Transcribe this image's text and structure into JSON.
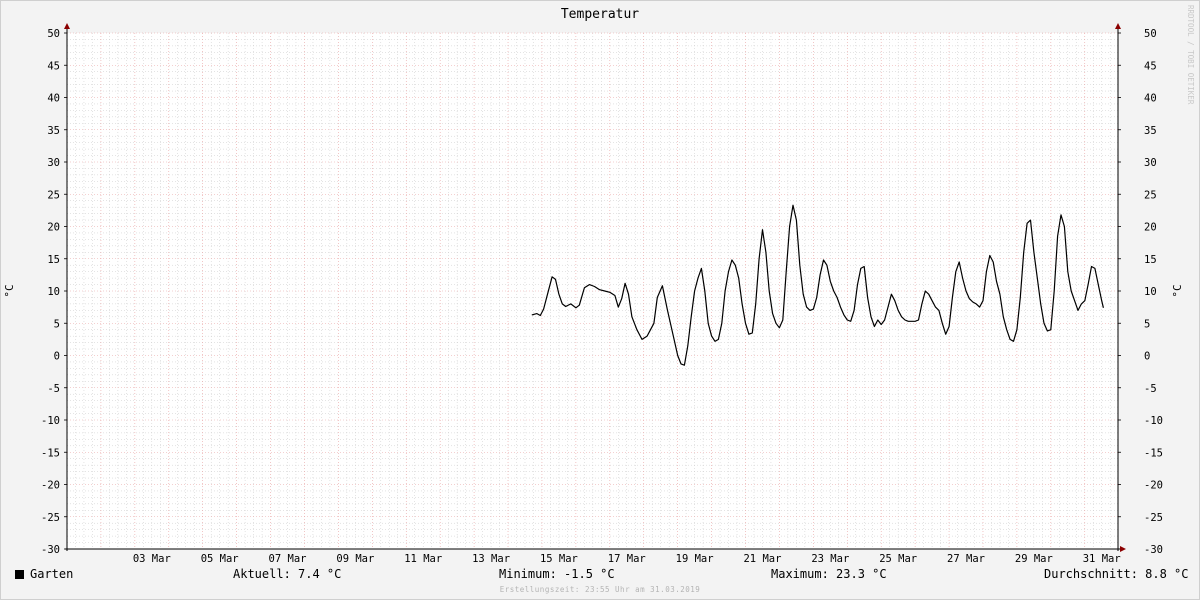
{
  "chart_data": {
    "type": "line",
    "title": "Temperatur",
    "ylabel": "°C",
    "ylim": [
      -30,
      50
    ],
    "yticks": [
      -30,
      -25,
      -20,
      -15,
      -10,
      -5,
      0,
      5,
      10,
      15,
      20,
      25,
      30,
      35,
      40,
      45,
      50
    ],
    "xlim_days": [
      1,
      31
    ],
    "xtick_labels": [
      {
        "day": 3,
        "label": "03 Mar"
      },
      {
        "day": 5,
        "label": "05 Mar"
      },
      {
        "day": 7,
        "label": "07 Mar"
      },
      {
        "day": 9,
        "label": "09 Mar"
      },
      {
        "day": 11,
        "label": "11 Mar"
      },
      {
        "day": 13,
        "label": "13 Mar"
      },
      {
        "day": 15,
        "label": "15 Mar"
      },
      {
        "day": 17,
        "label": "17 Mar"
      },
      {
        "day": 19,
        "label": "19 Mar"
      },
      {
        "day": 21,
        "label": "21 Mar"
      },
      {
        "day": 23,
        "label": "23 Mar"
      },
      {
        "day": 25,
        "label": "25 Mar"
      },
      {
        "day": 27,
        "label": "27 Mar"
      },
      {
        "day": 29,
        "label": "29 Mar"
      },
      {
        "day": 31,
        "label": "31 Mar"
      }
    ],
    "grid": true,
    "series": [
      {
        "name": "Garten",
        "color": "#000000",
        "points": [
          [
            14.7,
            6.3
          ],
          [
            14.85,
            6.5
          ],
          [
            14.95,
            6.2
          ],
          [
            15.05,
            7.2
          ],
          [
            15.2,
            10.2
          ],
          [
            15.3,
            12.2
          ],
          [
            15.4,
            11.8
          ],
          [
            15.5,
            9.5
          ],
          [
            15.6,
            8.0
          ],
          [
            15.7,
            7.6
          ],
          [
            15.85,
            8.0
          ],
          [
            16.0,
            7.4
          ],
          [
            16.1,
            7.8
          ],
          [
            16.25,
            10.5
          ],
          [
            16.4,
            11.0
          ],
          [
            16.55,
            10.7
          ],
          [
            16.7,
            10.2
          ],
          [
            16.85,
            10.0
          ],
          [
            17.0,
            9.8
          ],
          [
            17.15,
            9.3
          ],
          [
            17.25,
            7.5
          ],
          [
            17.35,
            8.8
          ],
          [
            17.45,
            11.2
          ],
          [
            17.55,
            9.5
          ],
          [
            17.65,
            6.0
          ],
          [
            17.8,
            4.0
          ],
          [
            17.95,
            2.5
          ],
          [
            18.1,
            3.0
          ],
          [
            18.2,
            4.0
          ],
          [
            18.3,
            5.0
          ],
          [
            18.4,
            9.0
          ],
          [
            18.55,
            10.8
          ],
          [
            18.7,
            7.0
          ],
          [
            18.85,
            3.5
          ],
          [
            19.0,
            0.0
          ],
          [
            19.1,
            -1.3
          ],
          [
            19.2,
            -1.5
          ],
          [
            19.3,
            1.5
          ],
          [
            19.4,
            6.0
          ],
          [
            19.5,
            10.0
          ],
          [
            19.6,
            12.0
          ],
          [
            19.7,
            13.5
          ],
          [
            19.8,
            10.0
          ],
          [
            19.9,
            5.0
          ],
          [
            20.0,
            3.0
          ],
          [
            20.1,
            2.2
          ],
          [
            20.2,
            2.5
          ],
          [
            20.3,
            5.0
          ],
          [
            20.4,
            10.0
          ],
          [
            20.5,
            13.0
          ],
          [
            20.6,
            14.8
          ],
          [
            20.7,
            14.0
          ],
          [
            20.8,
            12.0
          ],
          [
            20.9,
            8.0
          ],
          [
            21.0,
            5.0
          ],
          [
            21.1,
            3.3
          ],
          [
            21.2,
            3.5
          ],
          [
            21.3,
            8.0
          ],
          [
            21.4,
            15.0
          ],
          [
            21.5,
            19.5
          ],
          [
            21.6,
            16.0
          ],
          [
            21.7,
            10.0
          ],
          [
            21.8,
            6.5
          ],
          [
            21.9,
            5.0
          ],
          [
            22.0,
            4.3
          ],
          [
            22.1,
            5.5
          ],
          [
            22.2,
            13.0
          ],
          [
            22.3,
            20.0
          ],
          [
            22.4,
            23.3
          ],
          [
            22.5,
            21.0
          ],
          [
            22.6,
            14.0
          ],
          [
            22.7,
            9.5
          ],
          [
            22.8,
            7.5
          ],
          [
            22.9,
            7.0
          ],
          [
            23.0,
            7.2
          ],
          [
            23.1,
            9.0
          ],
          [
            23.2,
            12.5
          ],
          [
            23.3,
            14.8
          ],
          [
            23.4,
            14.0
          ],
          [
            23.5,
            11.5
          ],
          [
            23.6,
            10.0
          ],
          [
            23.7,
            9.0
          ],
          [
            23.8,
            7.5
          ],
          [
            23.9,
            6.3
          ],
          [
            24.0,
            5.5
          ],
          [
            24.1,
            5.3
          ],
          [
            24.2,
            7.0
          ],
          [
            24.3,
            11.0
          ],
          [
            24.4,
            13.5
          ],
          [
            24.5,
            13.8
          ],
          [
            24.6,
            9.0
          ],
          [
            24.7,
            6.0
          ],
          [
            24.8,
            4.5
          ],
          [
            24.9,
            5.5
          ],
          [
            25.0,
            4.8
          ],
          [
            25.1,
            5.5
          ],
          [
            25.2,
            7.5
          ],
          [
            25.3,
            9.5
          ],
          [
            25.4,
            8.5
          ],
          [
            25.5,
            7.0
          ],
          [
            25.6,
            6.0
          ],
          [
            25.7,
            5.5
          ],
          [
            25.8,
            5.3
          ],
          [
            26.0,
            5.3
          ],
          [
            26.1,
            5.5
          ],
          [
            26.2,
            8.0
          ],
          [
            26.3,
            10.0
          ],
          [
            26.4,
            9.5
          ],
          [
            26.5,
            8.5
          ],
          [
            26.6,
            7.5
          ],
          [
            26.7,
            7.0
          ],
          [
            26.8,
            5.0
          ],
          [
            26.9,
            3.3
          ],
          [
            27.0,
            4.5
          ],
          [
            27.1,
            9.0
          ],
          [
            27.2,
            13.0
          ],
          [
            27.3,
            14.5
          ],
          [
            27.4,
            12.0
          ],
          [
            27.5,
            10.0
          ],
          [
            27.6,
            8.8
          ],
          [
            27.7,
            8.3
          ],
          [
            27.8,
            8.0
          ],
          [
            27.9,
            7.5
          ],
          [
            28.0,
            8.5
          ],
          [
            28.1,
            13.0
          ],
          [
            28.2,
            15.5
          ],
          [
            28.3,
            14.5
          ],
          [
            28.4,
            11.5
          ],
          [
            28.5,
            9.5
          ],
          [
            28.6,
            6.0
          ],
          [
            28.7,
            4.0
          ],
          [
            28.8,
            2.5
          ],
          [
            28.9,
            2.2
          ],
          [
            29.0,
            4.0
          ],
          [
            29.1,
            9.0
          ],
          [
            29.2,
            16.0
          ],
          [
            29.3,
            20.5
          ],
          [
            29.4,
            21.0
          ],
          [
            29.5,
            16.0
          ],
          [
            29.6,
            12.0
          ],
          [
            29.7,
            8.0
          ],
          [
            29.8,
            5.0
          ],
          [
            29.9,
            3.8
          ],
          [
            30.0,
            4.0
          ],
          [
            30.1,
            10.0
          ],
          [
            30.2,
            18.5
          ],
          [
            30.3,
            21.8
          ],
          [
            30.4,
            20.0
          ],
          [
            30.5,
            13.0
          ],
          [
            30.6,
            10.0
          ],
          [
            30.7,
            8.5
          ],
          [
            30.8,
            7.0
          ],
          [
            30.9,
            8.0
          ],
          [
            31.0,
            8.5
          ],
          [
            31.1,
            11.0
          ],
          [
            31.2,
            13.8
          ],
          [
            31.3,
            13.5
          ],
          [
            31.4,
            11.0
          ],
          [
            31.5,
            8.5
          ],
          [
            31.55,
            7.4
          ]
        ]
      }
    ]
  },
  "legend": {
    "series_name": "Garten",
    "current_label": "Aktuell:",
    "current_value": "7.4 °C",
    "min_label": "Minimum:",
    "min_value": "-1.5 °C",
    "max_label": "Maximum:",
    "max_value": "23.3 °C",
    "avg_label": "Durchschnitt:",
    "avg_value": "8.8 °C"
  },
  "footer_text": "Erstellungszeit: 23:55 Uhr am 31.03.2019",
  "watermark": "RRDTOOL / TOBI OETIKER",
  "colors": {
    "background": "#f3f3f3",
    "plot_background": "#ffffff",
    "major_grid": "#e8a0a0",
    "minor_grid": "#c8c8c8",
    "line": "#000000",
    "arrow": "#8b0000"
  }
}
